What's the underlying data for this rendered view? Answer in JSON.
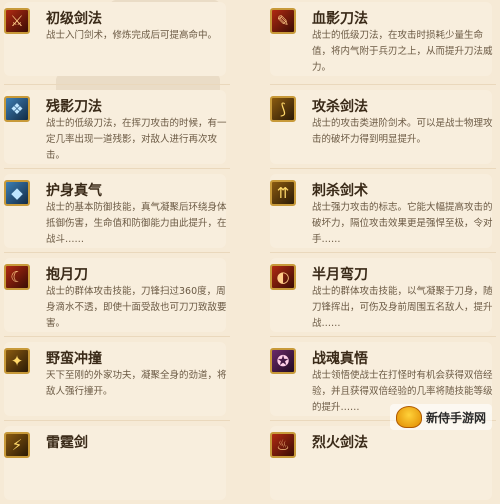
{
  "skills_left": [
    {
      "title": "初级剑法",
      "desc": "战士入门剑术，修炼完成后可提高命中。",
      "icon": "sword-icon"
    },
    {
      "title": "残影刀法",
      "desc": "战士的低级刀法，在挥刀攻击的时候，有一定几率出现一道残影，对敌人进行再次攻击。",
      "icon": "crystal-icon"
    },
    {
      "title": "护身真气",
      "desc": "战士的基本防御技能，真气凝聚后环绕身体抵御伤害，生命值和防御能力由此提升，在战斗……",
      "icon": "shield-crystal-icon"
    },
    {
      "title": "抱月刀",
      "desc": "战士的群体攻击技能，刀锋扫过360度，周身滴水不透，即使十面受敌也可刀刀致敌要害。",
      "icon": "crescent-blade-icon"
    },
    {
      "title": "野蛮冲撞",
      "desc": "天下至刚的外家功夫，凝聚全身的劲道，将敌人强行撞开。",
      "icon": "charge-icon"
    },
    {
      "title": "雷霆剑",
      "desc": "",
      "icon": "lightning-sword-icon"
    }
  ],
  "skills_right": [
    {
      "title": "血影刀法",
      "desc": "战士的低级刀法，在攻击时损耗少量生命值，将内气附于兵刃之上，从而提升刀法威力。",
      "icon": "blood-blade-icon"
    },
    {
      "title": "攻杀剑法",
      "desc": "战士的攻击类进阶剑术。可以是战士物理攻击的破坏力得到明显提升。",
      "icon": "slash-icon"
    },
    {
      "title": "刺杀剑术",
      "desc": "战士强力攻击的标志。它能大幅提高攻击的破坏力，隔位攻击效果更是强悍至极，令对手……",
      "icon": "thrust-icon"
    },
    {
      "title": "半月弯刀",
      "desc": "战士的群体攻击技能，以气凝聚于刀身，随刀锋挥出，可伤及身前周围五名敌人，提升战……",
      "icon": "half-moon-icon"
    },
    {
      "title": "战魂真悟",
      "desc": "战士领悟使战士在打怪时有机会获得双倍经验，并且获得双倍经验的几率将随技能等级的提升……",
      "icon": "war-soul-icon"
    },
    {
      "title": "烈火剑法",
      "desc": "",
      "icon": "flame-sword-icon"
    }
  ],
  "watermark": {
    "text": "新侍手游网"
  }
}
